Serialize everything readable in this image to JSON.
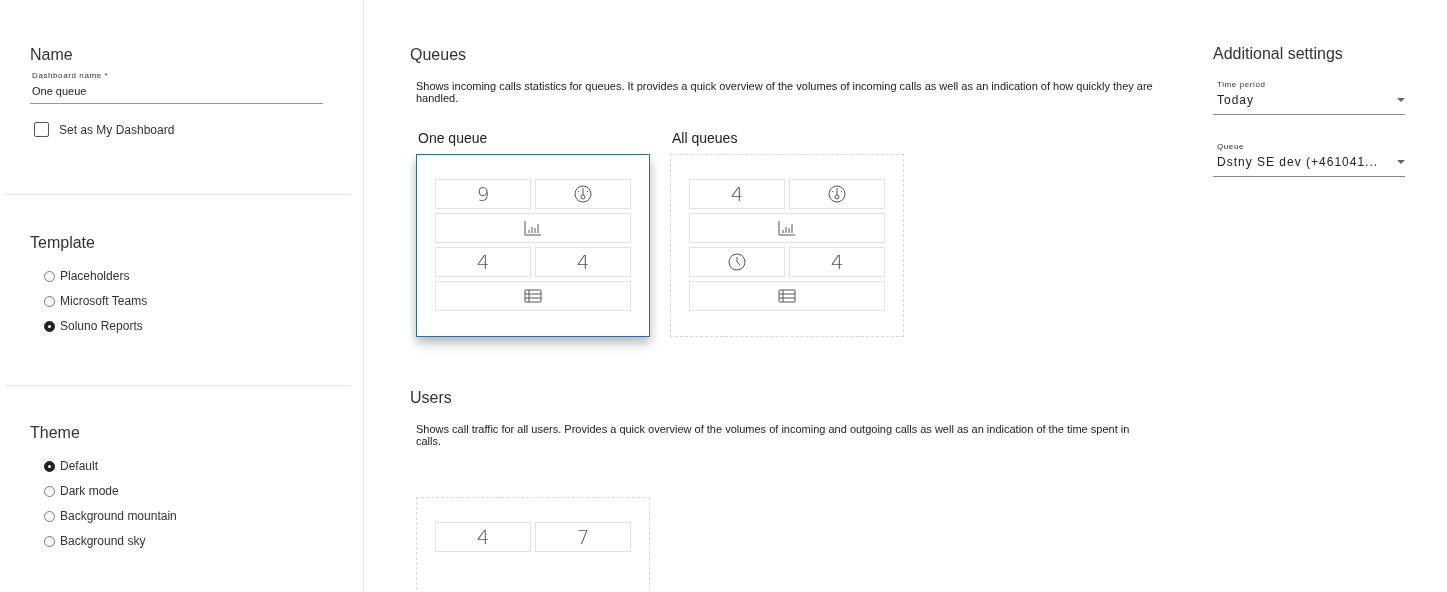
{
  "sidebar": {
    "name": {
      "heading": "Name",
      "field": {
        "label": "Dashboard name *",
        "value": "One queue"
      },
      "my_dashboard": {
        "label": "Set as My Dashboard",
        "checked": false
      }
    },
    "template": {
      "heading": "Template",
      "options": [
        {
          "label": "Placeholders",
          "selected": false
        },
        {
          "label": "Microsoft Teams",
          "selected": false
        },
        {
          "label": "Soluno Reports",
          "selected": true
        }
      ]
    },
    "theme": {
      "heading": "Theme",
      "options": [
        {
          "label": "Default",
          "selected": true
        },
        {
          "label": "Dark mode",
          "selected": false
        },
        {
          "label": "Background mountain",
          "selected": false
        },
        {
          "label": "Background sky",
          "selected": false
        }
      ]
    }
  },
  "sections": [
    {
      "heading": "Queues",
      "description": "Shows incoming calls statistics for queues. It provides a quick overview of the volumes of incoming calls as well as an indication of how quickly they are handled.",
      "templates": [
        {
          "title": "One queue",
          "selected": true,
          "rows": [
            [
              {
                "kind": "number",
                "text": "9"
              },
              {
                "kind": "gauge"
              }
            ],
            [
              {
                "kind": "chart"
              }
            ],
            [
              {
                "kind": "number",
                "text": "4"
              },
              {
                "kind": "number",
                "text": "4"
              }
            ],
            [
              {
                "kind": "table"
              }
            ]
          ]
        },
        {
          "title": "All queues",
          "selected": false,
          "rows": [
            [
              {
                "kind": "number",
                "text": "4"
              },
              {
                "kind": "gauge"
              }
            ],
            [
              {
                "kind": "chart"
              }
            ],
            [
              {
                "kind": "clock"
              },
              {
                "kind": "number",
                "text": "4"
              }
            ],
            [
              {
                "kind": "table"
              }
            ]
          ]
        }
      ]
    },
    {
      "heading": "Users",
      "description": "Shows call traffic for all users. Provides a quick overview of the volumes of incoming and outgoing calls as well as an indication of the time spent in calls.",
      "templates": [
        {
          "selected": false,
          "rows": [
            [
              {
                "kind": "number",
                "text": "4"
              },
              {
                "kind": "number",
                "text": "7"
              }
            ]
          ]
        }
      ]
    }
  ],
  "additional_settings": {
    "heading": "Additional settings",
    "fields": [
      {
        "label": "Time period",
        "value": "Today"
      },
      {
        "label": "Queue",
        "value": "Dstny SE dev (+461041..."
      }
    ]
  }
}
